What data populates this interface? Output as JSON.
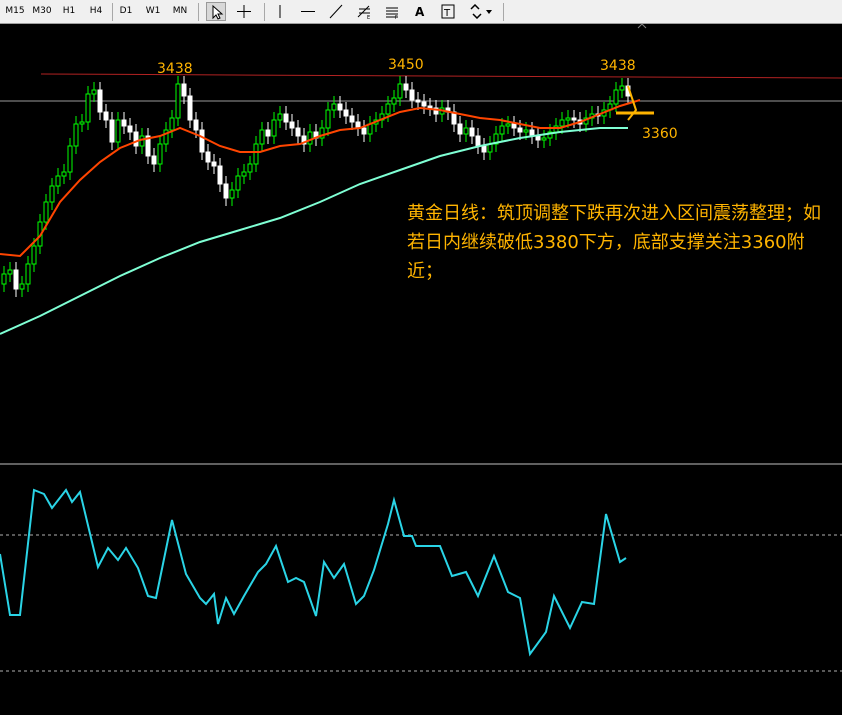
{
  "toolbar": {
    "timeframes": [
      "M15",
      "M30",
      "H1",
      "H4",
      "D1",
      "W1",
      "MN"
    ],
    "tools": [
      "cursor-icon",
      "crosshair-icon",
      "vertical-line-icon",
      "horizontal-line-icon",
      "trendline-icon",
      "fibonacci-icon",
      "fibo-fan-icon",
      "text-icon",
      "text-label-icon",
      "arrows-dropdown-icon"
    ]
  },
  "price_labels": {
    "high_left": "3438",
    "high_mid": "3450",
    "high_right": "3438",
    "support": "3360"
  },
  "annotation": {
    "text": "黄金日线：筑顶调整下跌再次进入区间震荡整理；如若日内继续破低3380下方，底部支撑关注3360附近；"
  },
  "colors": {
    "up_candle": "#00ff00",
    "down_candle": "#ffffff",
    "fast_ma": "#ff4500",
    "slow_ma": "#7fffd4",
    "resistance_line": "#b22222",
    "oscillator": "#2ad4e6",
    "annotation_text": "#ffb400"
  },
  "chart_data": {
    "type": "candlestick",
    "approx_price_levels": [
      3438,
      3450,
      3438,
      3360
    ]
  }
}
